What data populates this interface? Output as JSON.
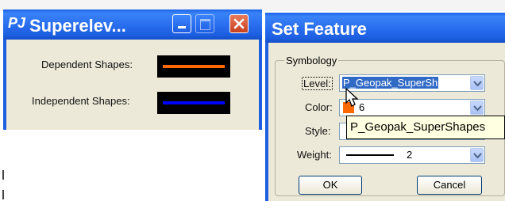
{
  "superelevation_window": {
    "title": "Superelev...",
    "app_icon_glyph": "PJ",
    "dependent_label": "Dependent Shapes:",
    "independent_label": "Independent Shapes:",
    "dependent_color": "#ff6a00",
    "independent_color": "#0000ff",
    "buttons": [
      "minimize",
      "maximize",
      "close"
    ]
  },
  "set_feature_window": {
    "title": "Set Feature",
    "group_label": "Symbology",
    "fields": {
      "level": {
        "label": "Level:",
        "value": "P_Geopak_SuperSh"
      },
      "color": {
        "label": "Color:",
        "value": "6",
        "swatch": "#ff6a00"
      },
      "style": {
        "label": "Style:",
        "value": ""
      },
      "weight": {
        "label": "Weight:",
        "value": "2"
      }
    },
    "ok_label": "OK",
    "cancel_label": "Cancel"
  },
  "tooltip": {
    "text": "P_Geopak_SuperShapes"
  }
}
